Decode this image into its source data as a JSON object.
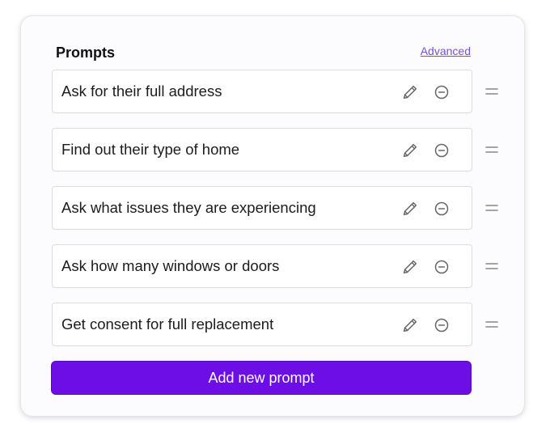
{
  "panel": {
    "title": "Prompts",
    "advanced_link": "Advanced"
  },
  "prompts": [
    {
      "text": "Ask for their full address"
    },
    {
      "text": "Find out their type of home"
    },
    {
      "text": "Ask what issues they are experiencing"
    },
    {
      "text": "Ask how many windows or doors"
    },
    {
      "text": "Get consent for full replacement"
    }
  ],
  "icons": {
    "edit": "pencil-icon",
    "remove": "minus-circle-icon",
    "drag": "drag-handle-icon"
  },
  "actions": {
    "add_label": "Add new prompt"
  },
  "colors": {
    "accent": "#6d0ee6",
    "link": "#7a4de0",
    "icon": "#666666"
  }
}
